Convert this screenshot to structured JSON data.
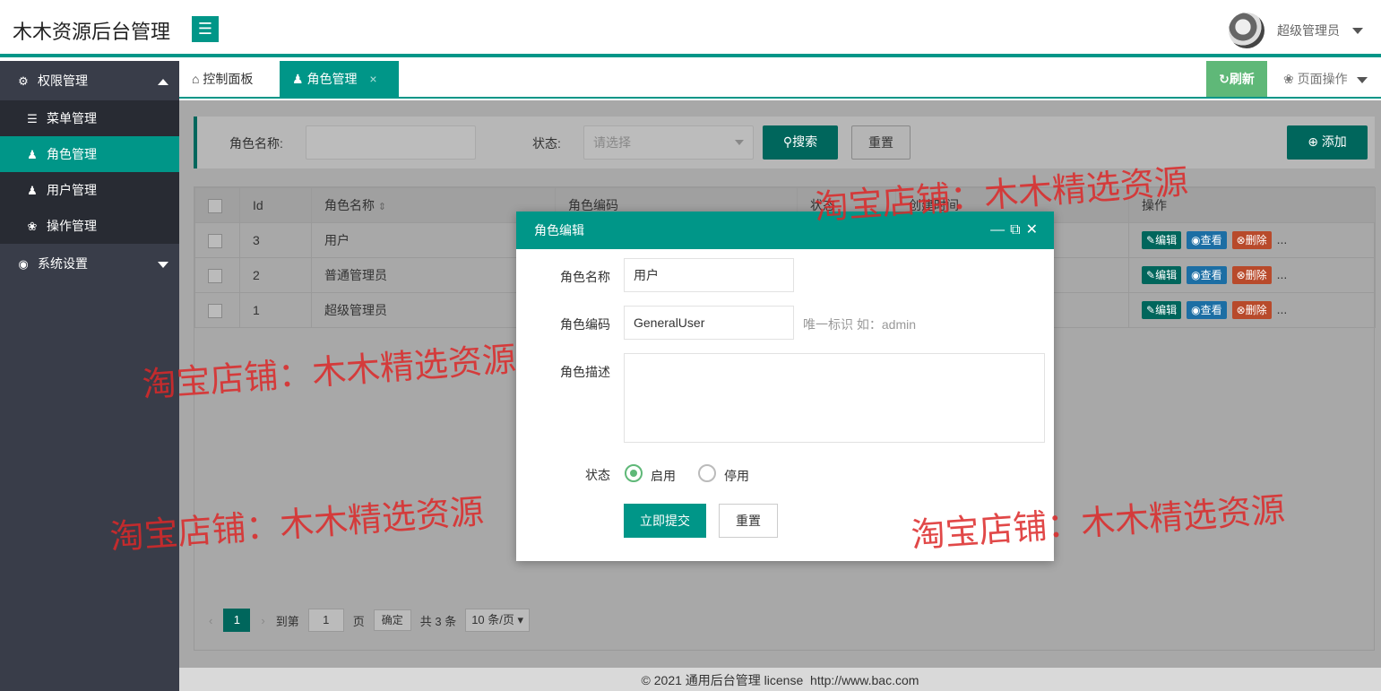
{
  "header": {
    "app_title": "木木资源后台管理",
    "menu_toggle_icon": "hamburger-icon",
    "user_name": "超级管理员"
  },
  "sidebar": {
    "sections": [
      {
        "label": "权限管理",
        "icon": "gears-icon",
        "expanded": true
      },
      {
        "label": "系统设置",
        "icon": "globe-icon",
        "expanded": false
      }
    ],
    "items": [
      {
        "label": "菜单管理",
        "icon": "list-icon",
        "active": false
      },
      {
        "label": "角色管理",
        "icon": "users-icon",
        "active": true
      },
      {
        "label": "用户管理",
        "icon": "user-icon",
        "active": false
      },
      {
        "label": "操作管理",
        "icon": "flower-icon",
        "active": false
      }
    ]
  },
  "tabs": {
    "home_label": "控制面板",
    "active_label": "角色管理",
    "close_glyph": "×",
    "refresh_label": "刷新",
    "page_ops_label": "页面操作"
  },
  "search": {
    "role_name_label": "角色名称:",
    "status_label": "状态:",
    "status_placeholder": "请选择",
    "search_button": "搜索",
    "reset_button": "重置",
    "add_button": "添加"
  },
  "table": {
    "headers": [
      "Id",
      "角色名称",
      "角色编码",
      "状态",
      "创建时间",
      "操作"
    ],
    "rows": [
      {
        "id": "3",
        "name": "用户"
      },
      {
        "id": "2",
        "name": "普通管理员"
      },
      {
        "id": "1",
        "name": "超级管理员"
      }
    ],
    "actions": {
      "edit": "编辑",
      "view": "查看",
      "delete": "删除",
      "more": "..."
    }
  },
  "pager": {
    "current_page": "1",
    "goto_label": "到第",
    "goto_value": "1",
    "page_unit": "页",
    "confirm_button": "确定",
    "total_text": "共 3 条",
    "page_size": "10 条/页"
  },
  "footer": {
    "copyright": "© 2021 通用后台管理 license",
    "url": "http://www.bac.com"
  },
  "modal": {
    "title": "角色编辑",
    "name_label": "角色名称",
    "name_value": "用户",
    "code_label": "角色编码",
    "code_value": "GeneralUser",
    "code_hint": "唯一标识 如：admin",
    "desc_label": "角色描述",
    "desc_value": "",
    "status_label": "状态",
    "status_on_label": "启用",
    "status_off_label": "停用",
    "status_selected": "启用",
    "submit_button": "立即提交",
    "reset_button": "重置"
  },
  "watermark": "淘宝店铺：木木精选资源",
  "colors": {
    "primary": "#009688",
    "sidebar": "#393d49",
    "refresh": "#5fb878"
  }
}
